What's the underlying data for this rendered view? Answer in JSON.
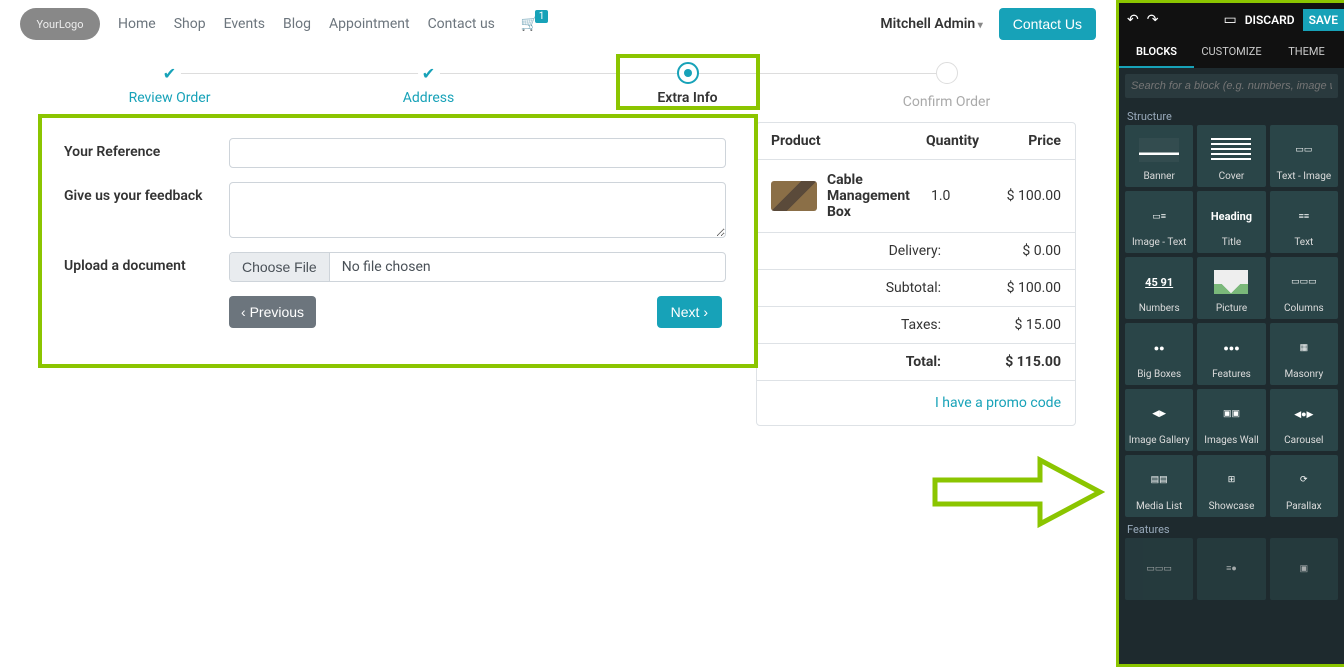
{
  "header": {
    "logo_main": "Your",
    "logo_sub": "Logo",
    "nav": [
      "Home",
      "Shop",
      "Events",
      "Blog",
      "Appointment",
      "Contact us"
    ],
    "cart_count": "1",
    "user": "Mitchell Admin",
    "contact_btn": "Contact Us"
  },
  "steps": [
    {
      "label": "Review Order",
      "state": "done"
    },
    {
      "label": "Address",
      "state": "done"
    },
    {
      "label": "Extra Info",
      "state": "current"
    },
    {
      "label": "Confirm Order",
      "state": "future"
    }
  ],
  "form": {
    "ref_label": "Your Reference",
    "ref_value": "",
    "feedback_label": "Give us your feedback",
    "feedback_value": "",
    "upload_label": "Upload a document",
    "choose_file": "Choose File",
    "no_file": "No file chosen",
    "prev": "Previous",
    "next": "Next"
  },
  "summary": {
    "head_product": "Product",
    "head_qty": "Quantity",
    "head_price": "Price",
    "item_name": "Cable Management Box",
    "item_qty": "1.0",
    "item_price": "$ 100.00",
    "delivery_label": "Delivery:",
    "delivery_val": "$ 0.00",
    "subtotal_label": "Subtotal:",
    "subtotal_val": "$ 100.00",
    "taxes_label": "Taxes:",
    "taxes_val": "$ 15.00",
    "total_label": "Total:",
    "total_val": "$ 115.00",
    "promo": "I have a promo code"
  },
  "editor": {
    "discard": "DISCARD",
    "save": "SAVE",
    "tabs": [
      "BLOCKS",
      "CUSTOMIZE",
      "THEME"
    ],
    "search_placeholder": "Search for a block (e.g. numbers, image wall, ...)",
    "section_structure": "Structure",
    "section_features": "Features",
    "blocks": [
      "Banner",
      "Cover",
      "Text - Image",
      "Image - Text",
      "Title",
      "Text",
      "Numbers",
      "Picture",
      "Columns",
      "Big Boxes",
      "Features",
      "Masonry",
      "Image Gallery",
      "Images Wall",
      "Carousel",
      "Media List",
      "Showcase",
      "Parallax"
    ]
  }
}
